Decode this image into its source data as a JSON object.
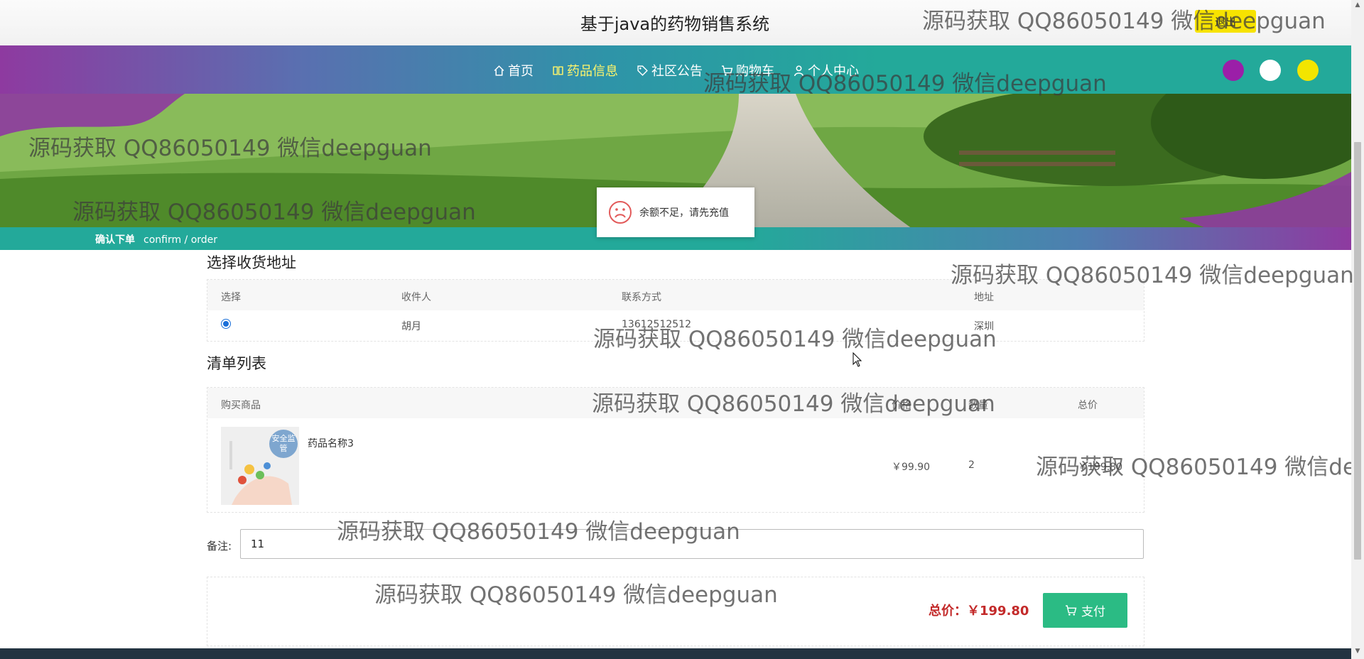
{
  "header": {
    "site_title": "基于java的药物销售系统",
    "logout_label": "退出"
  },
  "nav": {
    "items": [
      {
        "label": "首页",
        "icon": "home-icon",
        "active": false
      },
      {
        "label": "药品信息",
        "icon": "book-icon",
        "active": true
      },
      {
        "label": "社区公告",
        "icon": "tag-icon",
        "active": false
      },
      {
        "label": "购物车",
        "icon": "cart-icon",
        "active": false
      },
      {
        "label": "个人中心",
        "icon": "user-icon",
        "active": false
      }
    ],
    "theme_colors": [
      "#9b1fa8",
      "#ffffff",
      "#f2e500"
    ]
  },
  "breadcrumb": {
    "cn": "确认下单",
    "en": "confirm / order"
  },
  "toast": {
    "message": "余额不足，请先充值",
    "icon": "sad-face-icon"
  },
  "address": {
    "section_title": "选择收货地址",
    "columns": [
      "选择",
      "收件人",
      "联系方式",
      "地址"
    ],
    "rows": [
      {
        "selected": true,
        "recipient": "胡月",
        "phone": "13612512512",
        "address": "深圳"
      }
    ]
  },
  "order_list": {
    "section_title": "清单列表",
    "columns": [
      "购买商品",
      "价格",
      "数量",
      "总价"
    ],
    "items": [
      {
        "name": "药品名称3",
        "badge": "安全监管",
        "price": "￥99.90",
        "quantity": "2",
        "subtotal": "￥199.80"
      }
    ]
  },
  "remark": {
    "label": "备注:",
    "value": "11"
  },
  "summary": {
    "total_label": "总价：",
    "total_value": "￥199.80",
    "pay_label": "支付"
  },
  "watermark": "源码获取 QQ86050149 微信deepguan"
}
